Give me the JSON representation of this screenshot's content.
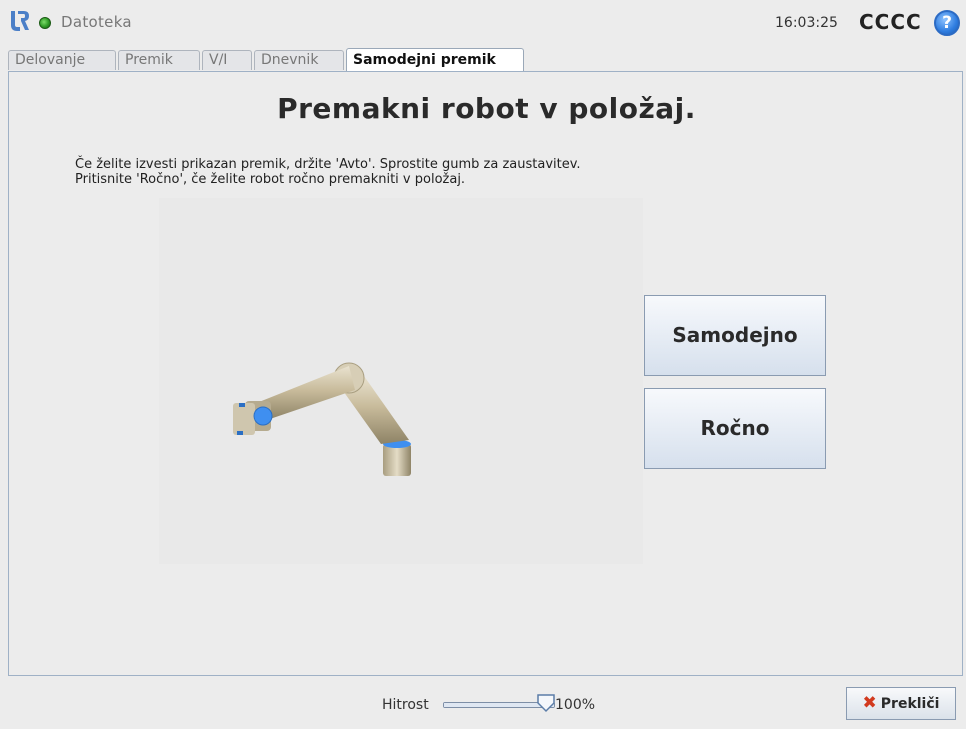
{
  "app": {
    "file_menu": "Datoteka",
    "time": "16:03:25",
    "robot_name": "CCCC",
    "help_symbol": "?"
  },
  "tabs": [
    {
      "label": "Delovanje",
      "active": false
    },
    {
      "label": "Premik",
      "active": false
    },
    {
      "label": "V/I",
      "active": false
    },
    {
      "label": "Dnevnik",
      "active": false
    },
    {
      "label": "Samodejni premik",
      "active": true
    }
  ],
  "main": {
    "title": "Premakni robot v položaj.",
    "instruction_line1": "Če želite izvesti prikazan premik, držite 'Avto'. Sprostite gumb za zaustavitev.",
    "instruction_line2": "Pritisnite 'Ročno', če želite robot ročno premakniti v položaj.",
    "auto_button": "Samodejno",
    "manual_button": "Ročno"
  },
  "footer": {
    "speed_label": "Hitrost",
    "speed_value": "100%",
    "speed_fraction": 1.0,
    "cancel_label": "Prekliči"
  },
  "colors": {
    "status_ok": "#2e9a25",
    "help": "#2f7de0",
    "cancel_icon": "#d23a1f",
    "joint_accent": "#3f8ff0"
  },
  "icons": [
    "ur-logo-icon",
    "status-dot-icon",
    "help-icon",
    "speed-thumb-icon",
    "cancel-x-icon",
    "robot-arm-image"
  ]
}
